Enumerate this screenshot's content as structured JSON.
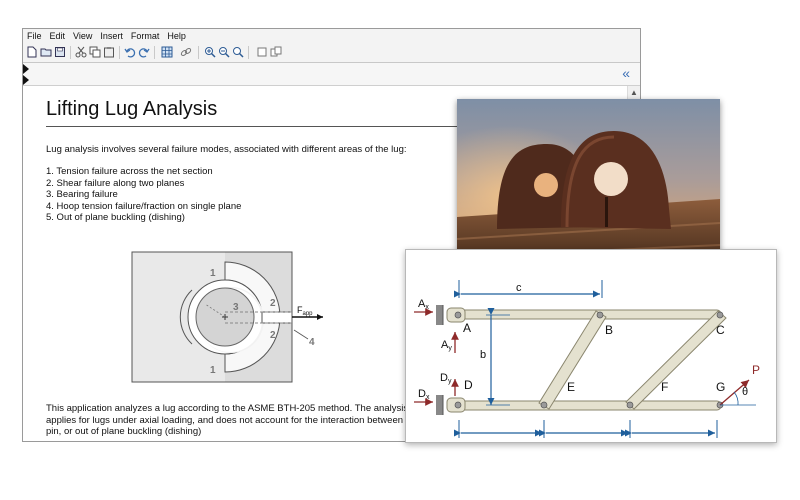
{
  "menu": [
    "File",
    "Edit",
    "View",
    "Insert",
    "Format",
    "Help"
  ],
  "toolbar_icons": [
    "new-doc-icon",
    "open-folder-icon",
    "save-icon",
    "cut-icon",
    "copy-icon",
    "paste-icon",
    "undo-icon",
    "redo-icon",
    "table-icon",
    "link-icon",
    "zoom-in-icon",
    "zoom-out-icon",
    "zoom-fit-icon",
    "view-a-icon",
    "view-b-icon"
  ],
  "ruler": {
    "collapse_glyph": "«"
  },
  "doc": {
    "title": "Lifting Lug Analysis",
    "intro": "Lug analysis involves several failure modes, associated with different areas of the lug:",
    "modes": [
      "1. Tension failure across the net section",
      "2. Shear failure along two planes",
      "3. Bearing failure",
      "4. Hoop tension failure/fraction on single plane",
      "5. Out of plane buckling (dishing)"
    ],
    "para": [
      "This application analyzes a lug according to the ASME BTH-205 method. The analysis",
      "applies for lugs under axial loading, and does not account for the interaction between",
      "pin, or out of plane buckling (dishing)"
    ]
  },
  "lug_figure": {
    "labels": [
      "1",
      "2",
      "3",
      "2",
      "4",
      "1"
    ],
    "force_main": "F",
    "force_sub": "app"
  },
  "truss": {
    "dim_c": "c",
    "dim_b": "b",
    "nodes": [
      "A",
      "B",
      "C",
      "D",
      "E",
      "F",
      "G"
    ],
    "ax": "A",
    "ax_sub": "x",
    "ay": "A",
    "ay_sub": "y",
    "dx": "D",
    "dx_sub": "x",
    "dy": "D",
    "dy_sub": "y",
    "load": "P",
    "angle": "θ"
  },
  "colors": {
    "accent": "#2f6fb5",
    "member": "#e4e1cf",
    "member_stroke": "#8a866e",
    "dimension": "#1f5f9c",
    "force": "#8e2a2a"
  }
}
